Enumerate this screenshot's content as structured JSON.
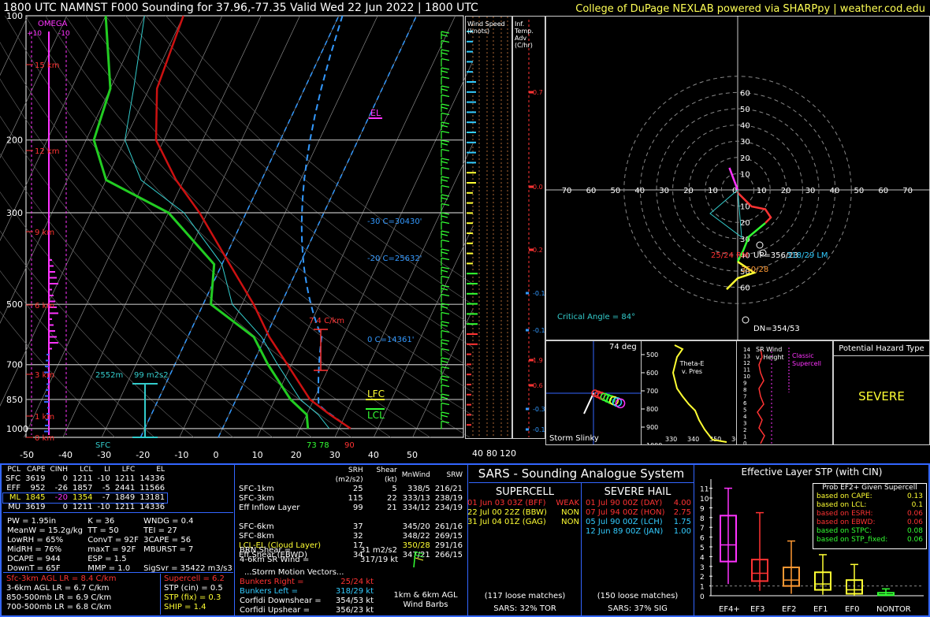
{
  "header": {
    "title": "1800 UTC NAMNST F000 Sounding for 37.96,-77.35 Valid  Wed 22 Jun 2022 | 1800 UTC",
    "credit": "College of DuPage NEXLAB powered via SHARPpy | weather.cod.edu"
  },
  "chart_data": [
    {
      "type": "line",
      "name": "skewt",
      "title": "",
      "y_ticks": [
        "100",
        "200",
        "300",
        "500",
        "700",
        "850",
        "1000"
      ],
      "x_ticks": [
        "-50",
        "-40",
        "-30",
        "-20",
        "-10",
        "0",
        "10",
        "20",
        "30",
        "40",
        "50"
      ],
      "height_labels": [
        "15 km",
        "12 km",
        "9 km",
        "6 km",
        "3 km",
        "1 km",
        "0 km"
      ],
      "omega_label": "OMEGA",
      "omega_ticks": [
        "+10",
        "-10"
      ],
      "temperature_c": [
        [
          1000,
          33
        ],
        [
          925,
          26
        ],
        [
          850,
          19
        ],
        [
          700,
          9
        ],
        [
          600,
          1
        ],
        [
          500,
          -7
        ],
        [
          400,
          -18
        ],
        [
          300,
          -32
        ],
        [
          250,
          -42
        ],
        [
          200,
          -52
        ],
        [
          150,
          -58
        ],
        [
          100,
          -60
        ]
      ],
      "dewpoint_c": [
        [
          1000,
          22
        ],
        [
          925,
          20
        ],
        [
          850,
          14
        ],
        [
          700,
          4
        ],
        [
          600,
          -3
        ],
        [
          500,
          -18
        ],
        [
          400,
          -22
        ],
        [
          300,
          -40
        ],
        [
          250,
          -60
        ],
        [
          200,
          -68
        ],
        [
          150,
          -70
        ],
        [
          100,
          -80
        ]
      ],
      "annotations": {
        "el": "EL",
        "lfc": "LFC",
        "lcl": "LCL",
        "lapse": "7.4 C/km",
        "minus30": "-30 C=30430'",
        "minus20": "-20 C=25632'",
        "zero": "0 C=14361'",
        "eff_inflow": "99 m2s2",
        "eff_base": "2552m",
        "sfc": "SFC",
        "sfc_t": "90",
        "sfc_td": "73 78"
      }
    },
    {
      "type": "scatter",
      "name": "hodograph",
      "rings": [
        "10",
        "20",
        "30",
        "40",
        "50",
        "60"
      ],
      "x_ticks": [
        "70",
        "60",
        "50",
        "40",
        "30",
        "20",
        "10",
        "0",
        "10",
        "20",
        "30",
        "40",
        "50",
        "60",
        "70"
      ],
      "labels": {
        "rm": "25/24 RM",
        "up": "UP=356/23",
        "lm": "318/29 LM",
        "mw": "350/28",
        "dn": "DN=354/53",
        "critical": "Critical Angle = 84°"
      }
    }
  ],
  "wind_panel": {
    "label": "Wind Speed (knots)",
    "ticks": [
      "40",
      "80",
      "120"
    ]
  },
  "adv_panel": {
    "label": "Inf. Temp. Adv (C/hr)",
    "values": [
      "0.7",
      "0.0",
      "0.2",
      "-0.1",
      "-0.1",
      "1.9",
      "0.6",
      "-0.3",
      "-0.1"
    ]
  },
  "slinky": {
    "deg": "74 deg",
    "label": "Storm Slinky"
  },
  "thetae": {
    "label": "Theta-E v. Pres",
    "y_ticks": [
      "500",
      "600",
      "700",
      "800",
      "900",
      "1000"
    ],
    "x_ticks": [
      "330",
      "340",
      "350",
      "360"
    ]
  },
  "srwind": {
    "label": "SR Wind v. Height",
    "classic": "Classic Supercell",
    "y_ticks": [
      "14",
      "13",
      "12",
      "11",
      "10",
      "9",
      "8",
      "7",
      "6",
      "5",
      "4",
      "3",
      "2",
      "1",
      "0"
    ]
  },
  "hazard": {
    "title": "Potential Hazard Type",
    "value": "SEVERE"
  },
  "parcels": {
    "headers": [
      "PCL",
      "CAPE",
      "CINH",
      "LCL",
      "LI",
      "LFC",
      "EL"
    ],
    "rows": [
      [
        "SFC",
        "3619",
        "0",
        "1211",
        "-10",
        "1211",
        "14336"
      ],
      [
        "EFF",
        "952",
        "-26",
        "1857",
        "-5",
        "2441",
        "11566"
      ],
      [
        "ML",
        "1845",
        "-20",
        "1354",
        "-7",
        "1849",
        "13181"
      ],
      [
        "MU",
        "3619",
        "0",
        "1211",
        "-10",
        "1211",
        "14336"
      ]
    ]
  },
  "indices": [
    [
      "PW = 1.95in",
      "K = 36",
      "WNDG = 0.4"
    ],
    [
      "MeanW = 15.2g/kg",
      "TT = 50",
      "TEI = 27"
    ],
    [
      "LowRH = 65%",
      "ConvT = 92F",
      "3CAPE = 56"
    ],
    [
      "MidRH = 76%",
      "maxT = 92F",
      "MBURST = 7"
    ],
    [
      "DCAPE = 944",
      "ESP = 1.5",
      ""
    ],
    [
      "DownT = 65F",
      "MMP = 1.0",
      "SigSvr = 35422 m3/s3"
    ]
  ],
  "lapse": [
    "Sfc-3km AGL LR = 8.4 C/km",
    "3-6km AGL LR = 6.7 C/km",
    "850-500mb LR = 6.9 C/km",
    "700-500mb LR = 6.8 C/km"
  ],
  "composite": [
    "Supercell = 6.2",
    "STP (cin) = 0.5",
    "STP (fix) = 0.3",
    "SHIP = 1.4"
  ],
  "kinematics": {
    "headers": [
      "",
      "SRH (m2/s2)",
      "Shear (kt)",
      "MnWind",
      "SRW"
    ],
    "rows": [
      [
        "SFC-1km",
        "25",
        "5",
        "338/5",
        "216/21"
      ],
      [
        "SFC-3km",
        "115",
        "22",
        "333/13",
        "238/19"
      ],
      [
        "Eff Inflow Layer",
        "99",
        "21",
        "334/12",
        "234/19"
      ],
      [
        "",
        "",
        "",
        "",
        ""
      ],
      [
        "SFC-6km",
        "37",
        "345/20",
        "261/16",
        ""
      ],
      [
        "SFC-8km",
        "32",
        "348/22",
        "269/15",
        ""
      ],
      [
        "LCL-EL (Cloud Layer)",
        "17",
        "350/28",
        "291/16",
        ""
      ],
      [
        "Eff Shear (EBWD)",
        "34",
        "347/21",
        "266/15",
        ""
      ]
    ],
    "brn": "BRN Shear =",
    "brn_val": "31 m2/s2",
    "srw46": "4-6km SR Wind =",
    "srw46_val": "317/19 kt",
    "motion_title": "...Storm Motion Vectors...",
    "motion": [
      [
        "Bunkers Right =",
        "25/24 kt"
      ],
      [
        "Bunkers Left =",
        "318/29 kt"
      ],
      [
        "Corfidi Downshear =",
        "354/53 kt"
      ],
      [
        "Corfidi Upshear =",
        "356/23 kt"
      ]
    ],
    "barbs_label": "1km & 6km AGL Wind Barbs"
  },
  "sars": {
    "title": "SARS - Sounding Analogue System",
    "supercell_title": "SUPERCELL",
    "hail_title": "SEVERE HAIL",
    "supercell": [
      [
        "01 Jun 03 03Z (BFF)",
        "WEAK"
      ],
      [
        "22 Jul 00 22Z (BBW)",
        "NON"
      ],
      [
        "31 Jul 04 01Z (GAG)",
        "NON"
      ]
    ],
    "hail": [
      [
        "01 Jul 90 00Z (DAY)",
        "4.00"
      ],
      [
        "07 Jul 94 00Z (HON)",
        "2.75"
      ],
      [
        "05 Jul 90 00Z (LCH)",
        "1.75"
      ],
      [
        "12 Jun 89 00Z (JAN)",
        "1.00"
      ]
    ],
    "sc_matches": "(117 loose matches)",
    "hail_matches": "(150 loose matches)",
    "sc_prob": "SARS: 32% TOR",
    "hail_prob": "SARS: 37% SIG"
  },
  "stp": {
    "title": "Effective Layer STP (with CIN)",
    "y_ticks": [
      "11",
      "10",
      "9",
      "8",
      "7",
      "6",
      "5",
      "4",
      "3",
      "2",
      "1",
      "0"
    ],
    "categories": [
      "EF4+",
      "EF3",
      "EF2",
      "EF1",
      "EF0",
      "NONTOR"
    ],
    "box_colors": [
      "#ff33ff",
      "#ff3333",
      "#ff9933",
      "#ffff33",
      "#ffff33",
      "#33ff33"
    ],
    "prob_title": "Prob EF2+ Given Supercell",
    "prob_rows": [
      [
        "based on CAPE:",
        "0.13"
      ],
      [
        "based on LCL:",
        "0.1"
      ],
      [
        "based on ESRH:",
        "0.06"
      ],
      [
        "based on EBWD:",
        "0.06"
      ],
      [
        "based on STPC:",
        "0.08"
      ],
      [
        "based on STP_fixed:",
        "0.06"
      ]
    ],
    "prob_colors": [
      "#ffff33",
      "#ffff33",
      "#ff3333",
      "#ff3333",
      "#33ff33",
      "#33ff33"
    ]
  }
}
